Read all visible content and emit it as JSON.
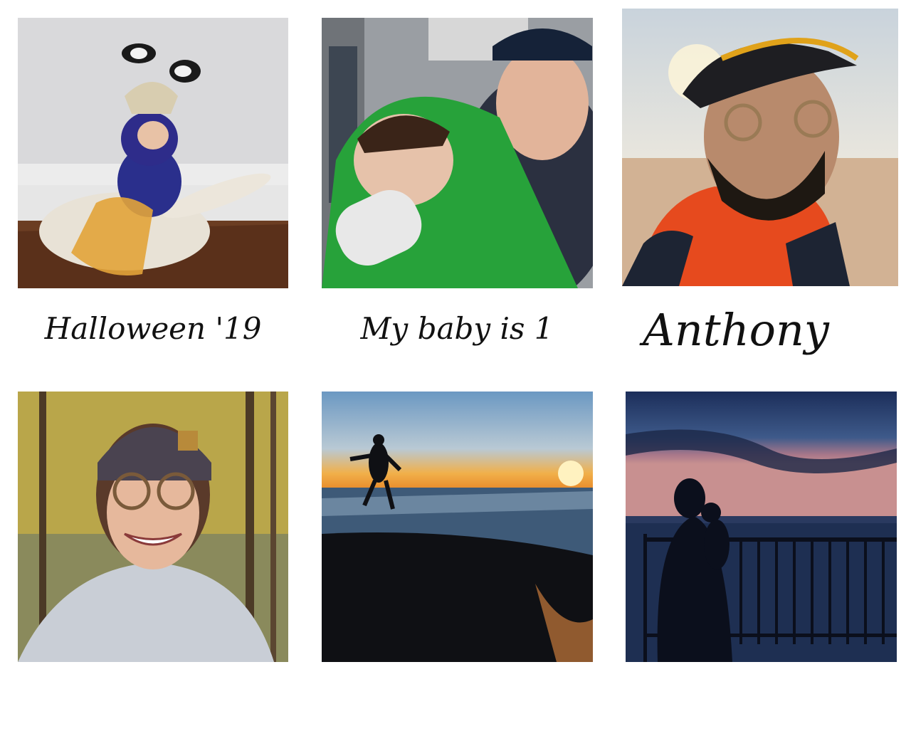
{
  "gallery": {
    "items": [
      {
        "caption": "Halloween '19",
        "subject": "baby in monster costume"
      },
      {
        "caption": "My baby is 1",
        "subject": "father and baby selfie"
      },
      {
        "caption": "Anthony",
        "subject": "bearded man in cap at beach"
      },
      {
        "caption": "",
        "subject": "woman in beanie smiling in woods"
      },
      {
        "caption": "",
        "subject": "silhouette running on beach at sunset"
      },
      {
        "caption": "",
        "subject": "silhouette holding child by railing at dusk"
      }
    ]
  }
}
